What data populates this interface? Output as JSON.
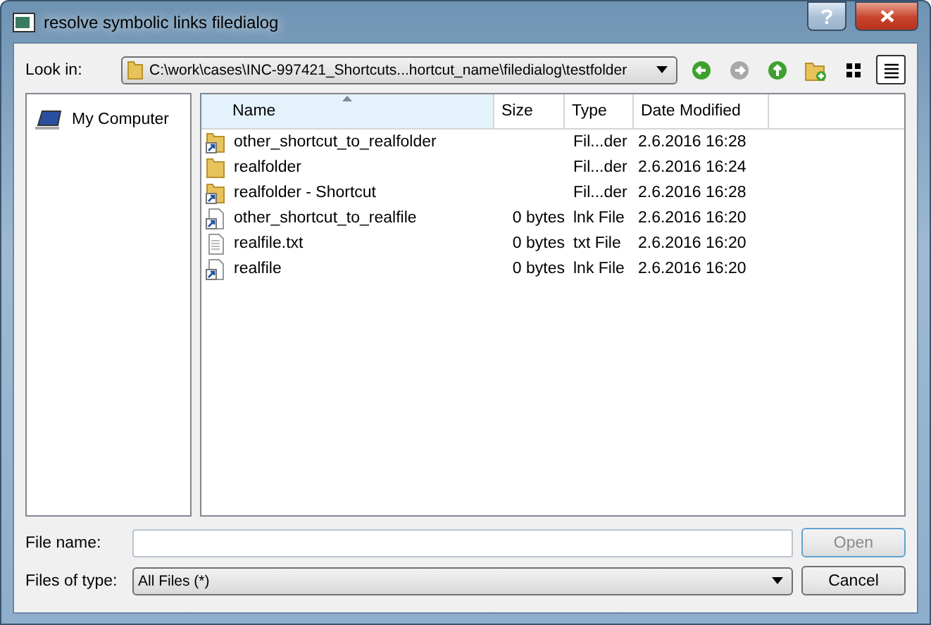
{
  "window": {
    "title": "resolve symbolic links filedialog"
  },
  "look_in": {
    "label": "Look in:",
    "path": "C:\\work\\cases\\INC-997421_Shortcuts...hortcut_name\\filedialog\\testfolder"
  },
  "nav_buttons": [
    {
      "kind": "back",
      "disabled": false
    },
    {
      "kind": "forward",
      "disabled": true
    },
    {
      "kind": "up",
      "disabled": false
    },
    {
      "kind": "new-folder",
      "disabled": false
    }
  ],
  "view_buttons": [
    {
      "kind": "list",
      "selected": false
    },
    {
      "kind": "detail",
      "selected": true
    }
  ],
  "sidebar": {
    "items": [
      {
        "label": "My Computer",
        "selected": false
      }
    ]
  },
  "table": {
    "columns": [
      "Name",
      "Size",
      "Type",
      "Date Modified"
    ],
    "rows": [
      {
        "kind": "folder-shortcut",
        "name": "other_shortcut_to_realfolder",
        "type": "Fil...der",
        "date": "2.6.2016 16:28"
      },
      {
        "kind": "folder",
        "name": "realfolder",
        "type": "Fil...der",
        "date": "2.6.2016 16:24"
      },
      {
        "kind": "folder-shortcut",
        "name": "realfolder - Shortcut",
        "type": "Fil...der",
        "date": "2.6.2016 16:28"
      },
      {
        "kind": "file-shortcut",
        "name": "other_shortcut_to_realfile",
        "size": "0 bytes",
        "type": "lnk File",
        "date": "2.6.2016 16:20"
      },
      {
        "kind": "text-file",
        "name": "realfile.txt",
        "size": "0 bytes",
        "type": "txt File",
        "date": "2.6.2016 16:20"
      },
      {
        "kind": "file-shortcut",
        "name": "realfile",
        "size": "0 bytes",
        "type": "lnk File",
        "date": "2.6.2016 16:20"
      }
    ]
  },
  "file_name": {
    "label": "File name:"
  },
  "file_type": {
    "label": "Files of type:",
    "value": "All Files (*)"
  },
  "buttons": [
    {
      "label": "Open",
      "disabled": true
    },
    {
      "label": "Cancel",
      "disabled": false
    }
  ]
}
